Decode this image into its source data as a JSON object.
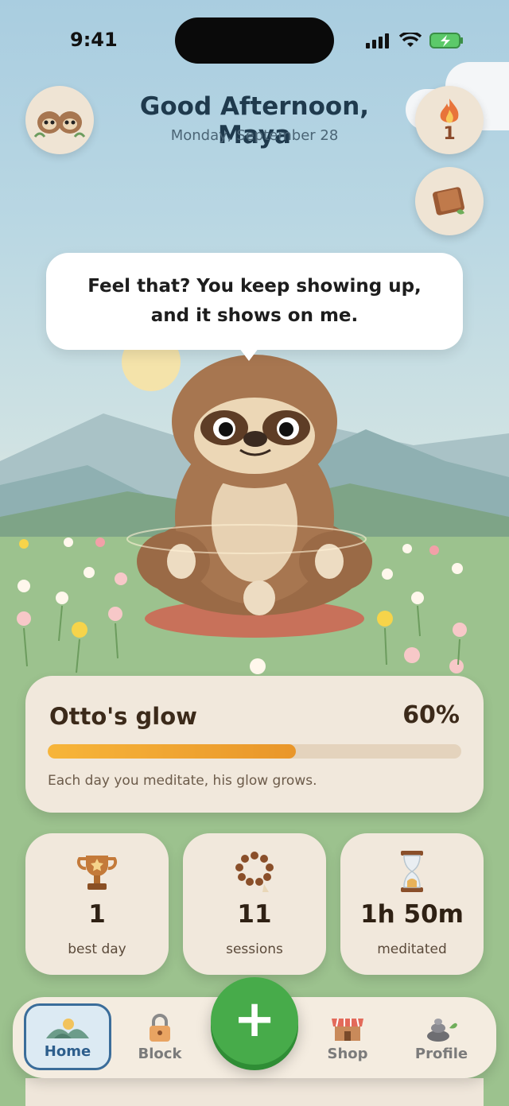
{
  "status_bar": {
    "time": "9:41"
  },
  "header": {
    "greeting": "Good Afternoon, Maya",
    "date": "Monday, September 28",
    "streak_count": "1"
  },
  "companion": {
    "speech": "Feel that? You keep showing up, and it shows on me."
  },
  "glow": {
    "title": "Otto's glow",
    "percent_label": "60%",
    "progress": 0.6,
    "subtitle": "Each day you meditate, his glow grows."
  },
  "stats": [
    {
      "value": "1",
      "label": "best day",
      "icon": "trophy-icon"
    },
    {
      "value": "11",
      "label": "sessions",
      "icon": "prayer-beads-icon"
    },
    {
      "value": "1h 50m",
      "label": "meditated",
      "icon": "hourglass-icon"
    }
  ],
  "tabs": [
    {
      "label": "Home",
      "icon": "home-landscape-icon",
      "active": true
    },
    {
      "label": "Block",
      "icon": "padlock-icon",
      "active": false
    },
    {
      "label": "Shop",
      "icon": "shop-icon",
      "active": false
    },
    {
      "label": "Profile",
      "icon": "stones-icon",
      "active": false
    }
  ],
  "add_button": {
    "symbol": "+"
  },
  "colors": {
    "accent_green": "#47ab4a",
    "glow_orange": "#f0a432",
    "active_tab_blue": "#3b6d9a",
    "card_bg": "#f1e8dc"
  }
}
